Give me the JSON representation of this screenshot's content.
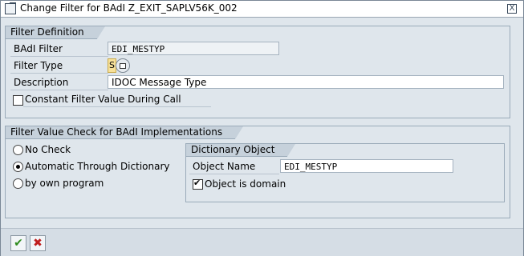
{
  "window": {
    "title": "Change Filter for BAdI Z_EXIT_SAPLV56K_002",
    "close_label": "X"
  },
  "filter_definition": {
    "group_title": "Filter Definition",
    "badi_filter_label": "BAdI Filter",
    "badi_filter_value": "EDI_MESTYP",
    "filter_type_label": "Filter Type",
    "filter_type_value": "S",
    "description_label": "Description",
    "description_value": "IDOC Message Type",
    "constant_label": "Constant Filter Value During Call",
    "constant_checked": false
  },
  "filter_check": {
    "group_title": "Filter Value Check for BAdI Implementations",
    "options": [
      {
        "label": "No Check",
        "selected": false
      },
      {
        "label": "Automatic Through Dictionary",
        "selected": true
      },
      {
        "label": "by own program",
        "selected": false
      }
    ],
    "dictionary": {
      "group_title": "Dictionary Object",
      "object_name_label": "Object Name",
      "object_name_value": "EDI_MESTYP",
      "domain_label": "Object is domain",
      "domain_checked": true
    }
  },
  "footer": {
    "ok_icon": "checkmark-icon",
    "cancel_icon": "cancel-x-icon",
    "ok_color": "#2f8b1f",
    "cancel_color": "#c01d1d"
  }
}
